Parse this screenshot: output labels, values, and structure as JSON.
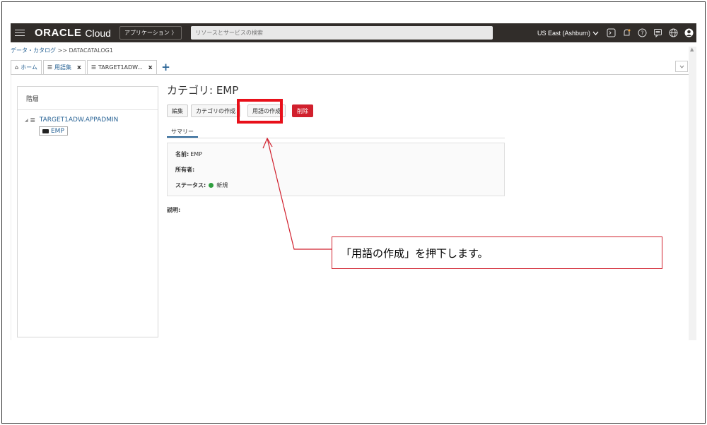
{
  "topnav": {
    "logo": "ORACLE",
    "logo_sub": "Cloud",
    "apps_button": "アプリケーション 〉",
    "search_placeholder": "リソースとサービスの検索",
    "region": "US East (Ashburn)",
    "icons": [
      "cloud-shell-icon",
      "bell-icon",
      "help-icon",
      "chat-icon",
      "globe-icon",
      "user-icon"
    ]
  },
  "breadcrumb": {
    "parent": "データ・カタログ",
    "separator": ">>",
    "current": "DATACATALOG1"
  },
  "tabs": [
    {
      "label": "ホーム",
      "icon": "home-icon",
      "closable": false
    },
    {
      "label": "用語集",
      "icon": "glossary-icon",
      "closable": true
    },
    {
      "label": "TARGET1ADW...",
      "icon": "glossary-icon",
      "closable": true
    }
  ],
  "tab_close": "x",
  "tab_add": "+",
  "hierarchy": {
    "title": "階層",
    "root": "TARGET1ADW.APPADMIN",
    "child": "EMP"
  },
  "page": {
    "title": "カテゴリ: EMP",
    "buttons": {
      "edit": "編集",
      "create_category": "カテゴリの作成",
      "create_term": "用語の作成",
      "delete": "削除"
    },
    "subtab": "サマリー",
    "summary": {
      "name_label": "名前:",
      "name_value": "EMP",
      "owner_label": "所有者:",
      "status_label": "ステータス:",
      "status_value": "新規"
    },
    "description_label": "説明:"
  },
  "annotation": {
    "text": "「用語の作成」を押下します。",
    "color": "#d1202d"
  }
}
